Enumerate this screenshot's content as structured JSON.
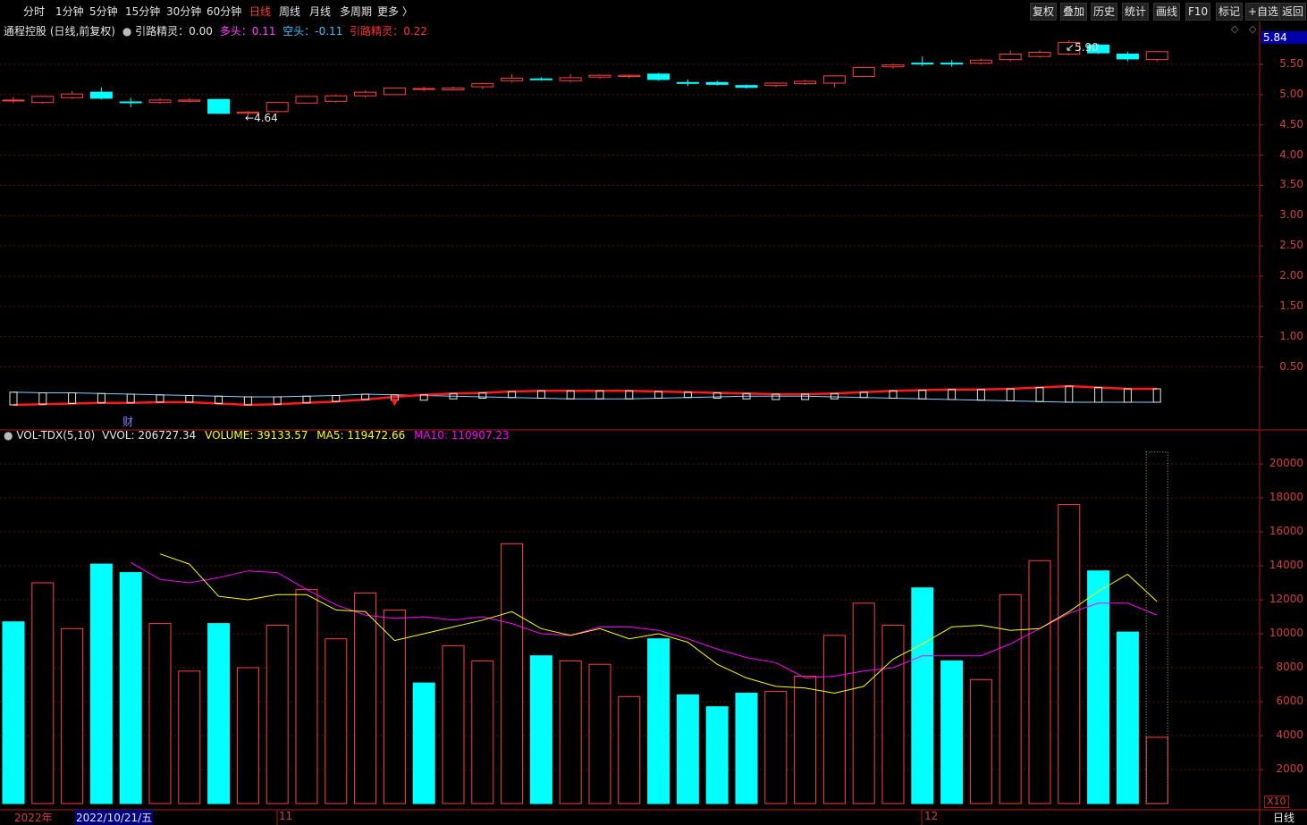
{
  "toolbar": {
    "periods": [
      "分时",
      "1分钟",
      "5分钟",
      "15分钟",
      "30分钟",
      "60分钟",
      "日线",
      "周线",
      "月线",
      "多周期",
      "更多 〉"
    ],
    "active_period": "日线",
    "buttons": [
      "复权",
      "叠加",
      "历史",
      "统计",
      "画线",
      "F10",
      "标记",
      "+自选",
      "返回"
    ]
  },
  "main_info": {
    "title": "通程控股 (日线,前复权)",
    "indicator": "引路精灵：0.00",
    "duotou_label": "多头：",
    "duotou_value": "0.11",
    "kongtou_label": "空头：",
    "kongtou_value": "-0.11",
    "yinlu_label": "引路精灵：",
    "yinlu_value": "0.22"
  },
  "current_price": "5.84",
  "price_annotations": {
    "low": "4.64",
    "high": "5.90"
  },
  "cai_mark": "财",
  "vol_info": {
    "name": "VOL-TDX(5,10)",
    "vvol": "VVOL: 206727.34",
    "volume": "VOLUME: 39133.57",
    "ma5": "MA5: 119472.66",
    "ma10": "MA10: 110907.23"
  },
  "vol_unit": "X10",
  "bottom": {
    "year": "2022年",
    "date": "2022/10/21/五",
    "month1": "11",
    "month2": "12",
    "period": "日线"
  },
  "colors": {
    "up": "#ff4040",
    "down": "#00ffff",
    "ma5": "#ffff00",
    "ma10": "#ff00ff",
    "axis": "#b01818",
    "grid": "#5a0f0f"
  },
  "chart_data": [
    {
      "type": "candlestick",
      "title": "通程控股 (日线,前复权)",
      "yticks": [
        0.5,
        1.0,
        1.5,
        2.0,
        2.5,
        3.0,
        3.5,
        4.0,
        4.5,
        5.0,
        5.5
      ],
      "ylim": [
        0.0,
        5.95
      ],
      "candles": [
        {
          "o": 4.91,
          "c": 4.91,
          "h": 4.96,
          "l": 4.86,
          "dir": "up"
        },
        {
          "o": 4.87,
          "c": 4.97,
          "h": 4.98,
          "l": 4.85,
          "dir": "up"
        },
        {
          "o": 4.95,
          "c": 5.01,
          "h": 5.06,
          "l": 4.93,
          "dir": "up"
        },
        {
          "o": 5.04,
          "c": 4.94,
          "h": 5.12,
          "l": 4.92,
          "dir": "down"
        },
        {
          "o": 4.88,
          "c": 4.88,
          "h": 4.95,
          "l": 4.79,
          "dir": "down"
        },
        {
          "o": 4.87,
          "c": 4.91,
          "h": 4.94,
          "l": 4.85,
          "dir": "up"
        },
        {
          "o": 4.91,
          "c": 4.89,
          "h": 4.94,
          "l": 4.87,
          "dir": "up"
        },
        {
          "o": 4.92,
          "c": 4.69,
          "h": 4.92,
          "l": 4.69,
          "dir": "down"
        },
        {
          "o": 4.69,
          "c": 4.71,
          "h": 4.73,
          "l": 4.64,
          "dir": "up"
        },
        {
          "o": 4.72,
          "c": 4.87,
          "h": 4.88,
          "l": 4.7,
          "dir": "up"
        },
        {
          "o": 4.86,
          "c": 4.97,
          "h": 4.98,
          "l": 4.85,
          "dir": "up"
        },
        {
          "o": 4.89,
          "c": 4.98,
          "h": 5.0,
          "l": 4.87,
          "dir": "up"
        },
        {
          "o": 4.98,
          "c": 5.04,
          "h": 5.07,
          "l": 4.95,
          "dir": "up"
        },
        {
          "o": 5.0,
          "c": 5.11,
          "h": 5.11,
          "l": 5.0,
          "dir": "up"
        },
        {
          "o": 5.1,
          "c": 5.1,
          "h": 5.13,
          "l": 5.06,
          "dir": "up"
        },
        {
          "o": 5.08,
          "c": 5.11,
          "h": 5.13,
          "l": 5.07,
          "dir": "up"
        },
        {
          "o": 5.13,
          "c": 5.18,
          "h": 5.2,
          "l": 5.09,
          "dir": "up"
        },
        {
          "o": 5.23,
          "c": 5.27,
          "h": 5.34,
          "l": 5.2,
          "dir": "up"
        },
        {
          "o": 5.26,
          "c": 5.26,
          "h": 5.29,
          "l": 5.23,
          "dir": "down"
        },
        {
          "o": 5.23,
          "c": 5.28,
          "h": 5.34,
          "l": 5.2,
          "dir": "up"
        },
        {
          "o": 5.29,
          "c": 5.32,
          "h": 5.33,
          "l": 5.26,
          "dir": "up"
        },
        {
          "o": 5.3,
          "c": 5.32,
          "h": 5.33,
          "l": 5.27,
          "dir": "up"
        },
        {
          "o": 5.34,
          "c": 5.25,
          "h": 5.36,
          "l": 5.23,
          "dir": "down"
        },
        {
          "o": 5.2,
          "c": 5.2,
          "h": 5.25,
          "l": 5.14,
          "dir": "down"
        },
        {
          "o": 5.2,
          "c": 5.17,
          "h": 5.23,
          "l": 5.15,
          "dir": "down"
        },
        {
          "o": 5.15,
          "c": 5.12,
          "h": 5.17,
          "l": 5.1,
          "dir": "down"
        },
        {
          "o": 5.15,
          "c": 5.19,
          "h": 5.2,
          "l": 5.13,
          "dir": "up"
        },
        {
          "o": 5.18,
          "c": 5.22,
          "h": 5.24,
          "l": 5.16,
          "dir": "up"
        },
        {
          "o": 5.19,
          "c": 5.31,
          "h": 5.32,
          "l": 5.12,
          "dir": "up"
        },
        {
          "o": 5.3,
          "c": 5.45,
          "h": 5.45,
          "l": 5.29,
          "dir": "up"
        },
        {
          "o": 5.46,
          "c": 5.49,
          "h": 5.51,
          "l": 5.43,
          "dir": "up"
        },
        {
          "o": 5.52,
          "c": 5.52,
          "h": 5.63,
          "l": 5.47,
          "dir": "down"
        },
        {
          "o": 5.52,
          "c": 5.52,
          "h": 5.57,
          "l": 5.46,
          "dir": "down"
        },
        {
          "o": 5.52,
          "c": 5.57,
          "h": 5.59,
          "l": 5.5,
          "dir": "up"
        },
        {
          "o": 5.58,
          "c": 5.67,
          "h": 5.73,
          "l": 5.55,
          "dir": "up"
        },
        {
          "o": 5.63,
          "c": 5.7,
          "h": 5.73,
          "l": 5.61,
          "dir": "up"
        },
        {
          "o": 5.67,
          "c": 5.86,
          "h": 5.9,
          "l": 5.65,
          "dir": "up"
        },
        {
          "o": 5.82,
          "c": 5.69,
          "h": 5.84,
          "l": 5.67,
          "dir": "down"
        },
        {
          "o": 5.67,
          "c": 5.59,
          "h": 5.71,
          "l": 5.55,
          "dir": "down"
        },
        {
          "o": 5.58,
          "c": 5.71,
          "h": 5.72,
          "l": 5.55,
          "dir": "up"
        }
      ],
      "red_line": [
        0.04,
        0.05,
        0.06,
        0.07,
        0.07,
        0.08,
        0.08,
        0.06,
        0.04,
        0.05,
        0.07,
        0.09,
        0.12,
        0.16,
        0.19,
        0.21,
        0.22,
        0.24,
        0.25,
        0.25,
        0.25,
        0.25,
        0.24,
        0.23,
        0.22,
        0.21,
        0.2,
        0.2,
        0.21,
        0.23,
        0.25,
        0.26,
        0.27,
        0.27,
        0.28,
        0.3,
        0.32,
        0.3,
        0.28,
        0.28
      ],
      "cyan_line": [
        0.23,
        0.22,
        0.22,
        0.21,
        0.2,
        0.19,
        0.18,
        0.17,
        0.16,
        0.16,
        0.17,
        0.18,
        0.2,
        0.19,
        0.18,
        0.17,
        0.16,
        0.15,
        0.14,
        0.13,
        0.13,
        0.13,
        0.14,
        0.15,
        0.16,
        0.17,
        0.17,
        0.17,
        0.16,
        0.15,
        0.14,
        0.13,
        0.12,
        0.11,
        0.1,
        0.09,
        0.08,
        0.08,
        0.08,
        0.08
      ]
    },
    {
      "type": "bar",
      "title": "VOL-TDX(5,10)",
      "unit": "X10",
      "ylim": [
        0,
        21000
      ],
      "yticks": [
        2000,
        4000,
        6000,
        8000,
        10000,
        12000,
        14000,
        16000,
        18000,
        20000
      ],
      "volumes": [
        10700,
        13000,
        10300,
        14100,
        13600,
        10600,
        7800,
        10600,
        8000,
        10500,
        12600,
        9700,
        12400,
        11400,
        7100,
        9300,
        8400,
        15300,
        8700,
        8400,
        8200,
        6300,
        9700,
        6400,
        5700,
        6500,
        6600,
        7500,
        9900,
        11800,
        10500,
        12700,
        8400,
        7300,
        12300,
        14300,
        17600,
        13700,
        10100,
        3900
      ],
      "dir": [
        "down",
        "up",
        "up",
        "down",
        "down",
        "up",
        "up",
        "down",
        "up",
        "up",
        "up",
        "up",
        "up",
        "up",
        "down",
        "up",
        "up",
        "up",
        "down",
        "up",
        "up",
        "up",
        "down",
        "down",
        "down",
        "down",
        "up",
        "up",
        "up",
        "up",
        "up",
        "down",
        "down",
        "up",
        "up",
        "up",
        "up",
        "down",
        "down",
        "up"
      ],
      "last_bar_max": 20700,
      "ma5": [
        14700,
        14100,
        12200,
        12000,
        12300,
        12300,
        11400,
        11300,
        9600,
        10000,
        10400,
        10800,
        11300,
        10300,
        9900,
        10300,
        9700,
        10000,
        9500,
        8200,
        7400,
        6900,
        6800,
        6500,
        6900,
        8500,
        9400,
        10400,
        10500,
        10200,
        10300,
        11300,
        12500,
        13500,
        11900
      ],
      "ma10": [
        14200,
        13200,
        13000,
        13300,
        13700,
        13600,
        12600,
        11700,
        11100,
        10900,
        11000,
        10800,
        11000,
        10600,
        10000,
        9900,
        10400,
        10400,
        10200,
        9700,
        9100,
        8600,
        8300,
        7400,
        7500,
        7800,
        8000,
        8700,
        8700,
        8700,
        9400,
        10300,
        11200,
        11800,
        11800,
        11100
      ]
    }
  ]
}
